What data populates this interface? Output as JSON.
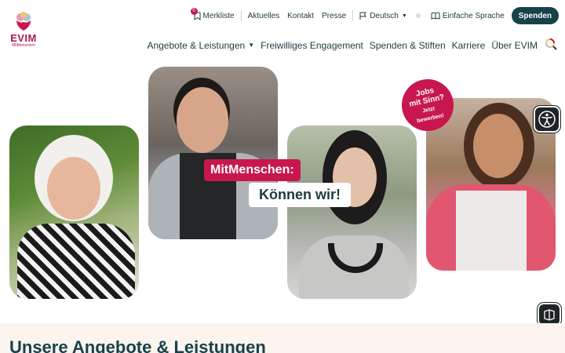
{
  "logo": {
    "wordmark": "EVIM",
    "subline": "MitMenschen"
  },
  "topbar": {
    "wishlist_label": "Merkliste",
    "wishlist_count": "0",
    "links": [
      "Aktuelles",
      "Kontakt",
      "Presse"
    ],
    "language": "Deutsch",
    "easy_language": "Einfache Sprache",
    "donate_button": "Spenden"
  },
  "main_nav": {
    "items": [
      "Angebote & Leistungen",
      "Freiwilliges Engagement",
      "Spenden & Stiften",
      "Karriere",
      "Über EVIM"
    ]
  },
  "hero": {
    "tagline_1": "MitMenschen:",
    "tagline_2": "Können wir!",
    "sticker_line_1": "Jobs",
    "sticker_line_2": "mit Sinn?",
    "sticker_line_3": "Jetzt",
    "sticker_line_4": "bewerben!"
  },
  "section": {
    "heading": "Unsere Angebote & Leistungen"
  },
  "colors": {
    "brand_pink": "#c8174f",
    "brand_teal": "#16434a",
    "section_bg": "#fcf4ef"
  },
  "icons": [
    "logo-heart-icon",
    "bookmark-icon",
    "flag-icon",
    "book-icon",
    "search-icon",
    "accessibility-icon",
    "reader-icon"
  ]
}
